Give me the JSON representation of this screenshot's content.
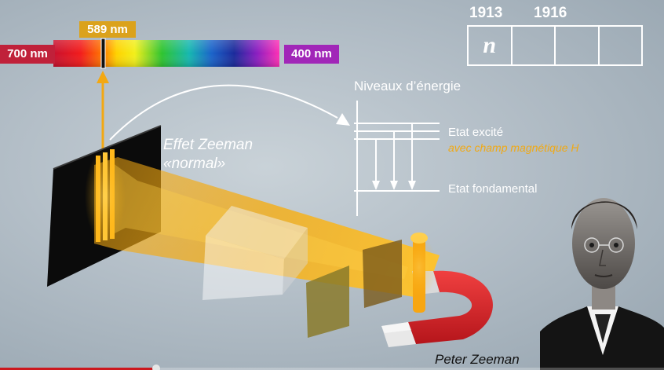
{
  "spectrum": {
    "label_red": "700 nm",
    "label_violet": "400 nm",
    "label_sodium": "589 nm"
  },
  "timeline": {
    "year_1": "1913",
    "year_2": "1916",
    "cell_symbol": "n"
  },
  "energy_levels": {
    "title": "Niveaux d’énergie",
    "excited": "Etat excité",
    "with_field": "avec champ magnétique H",
    "ground": "Etat fondamental"
  },
  "effect": {
    "line1": "Effet Zeeman",
    "line2": "«normal»"
  },
  "portrait": {
    "caption": "Peter Zeeman"
  },
  "video": {
    "progress_fraction": 0.235
  },
  "colors": {
    "beam": "#f3a812",
    "magnet_red": "#d41f26",
    "label_red": "#c0213a",
    "label_violet": "#a126b8",
    "label_sodium": "#dba21c",
    "highlight_text": "#f0a915"
  }
}
